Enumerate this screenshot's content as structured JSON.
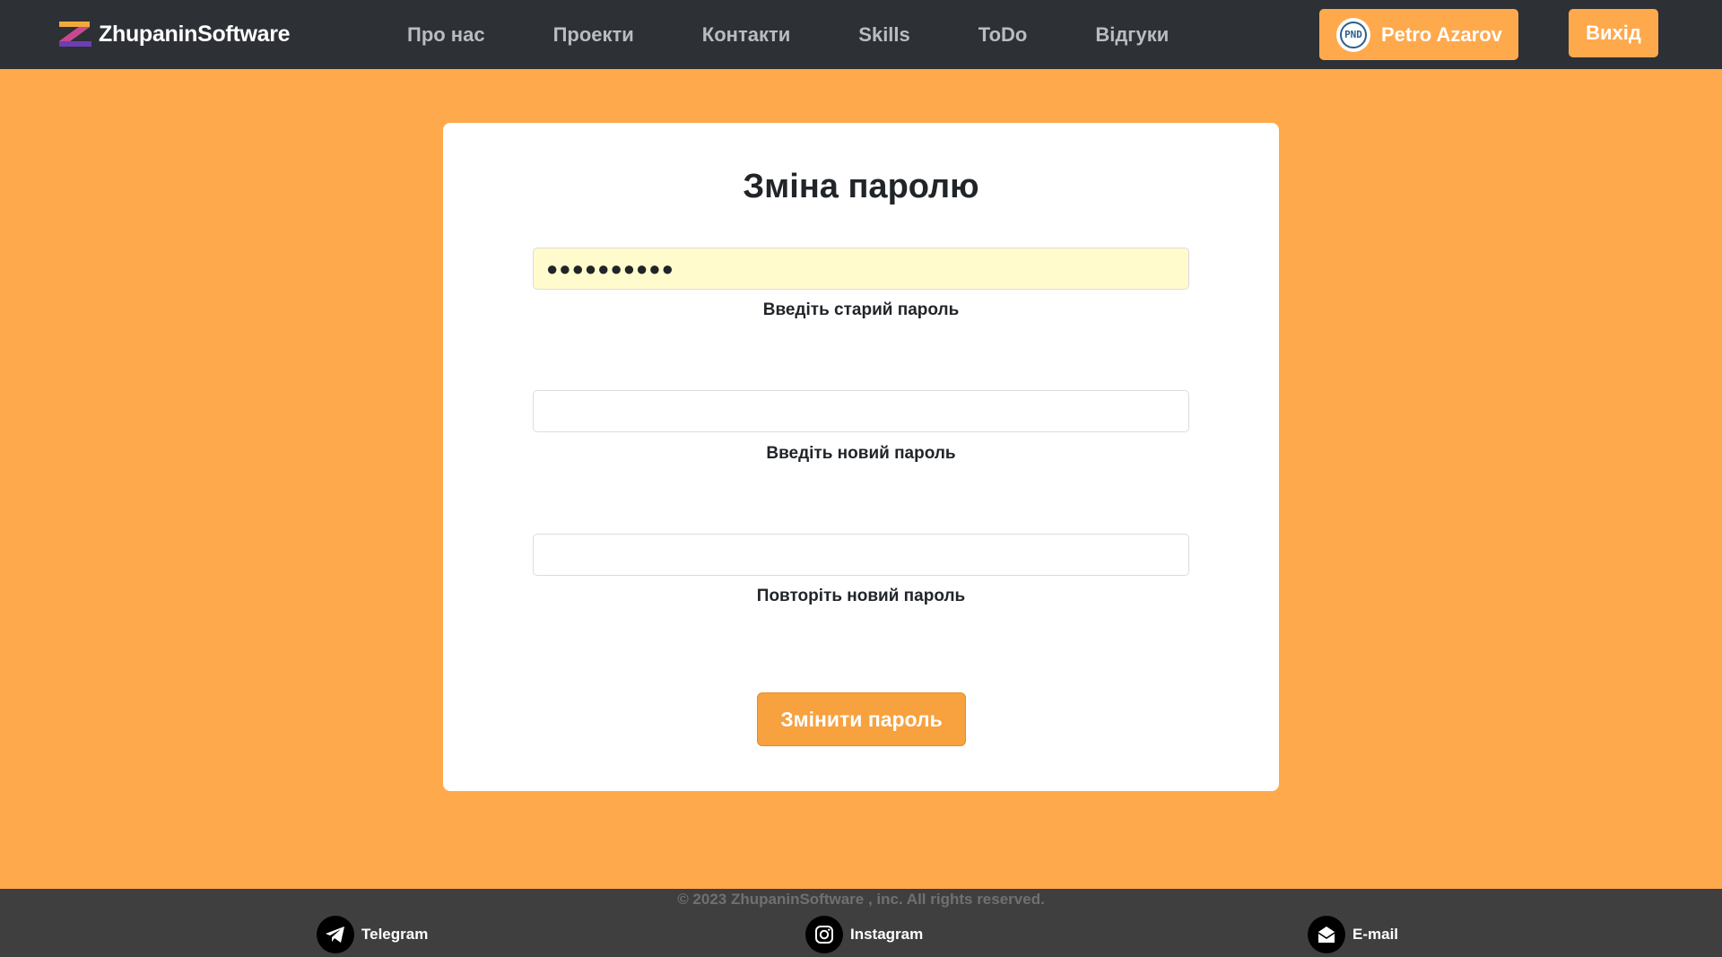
{
  "header": {
    "brand": "ZhupaninSoftware",
    "nav": [
      {
        "label": "Про нас"
      },
      {
        "label": "Проекти"
      },
      {
        "label": "Контакти"
      },
      {
        "label": "Skills"
      },
      {
        "label": "ToDo"
      },
      {
        "label": "Відгуки"
      }
    ],
    "user": {
      "name": "Petro Azarov",
      "avatar_text": "PND"
    },
    "logout_label": "Вихід"
  },
  "form": {
    "title": "Зміна паролю",
    "old_password": {
      "value": "●●●●●●●●●●",
      "label": "Введіть старий пароль"
    },
    "new_password": {
      "value": "",
      "label": "Введіть новий пароль"
    },
    "repeat_password": {
      "value": "",
      "label": "Повторіть новий пароль"
    },
    "submit_label": "Змінити пароль"
  },
  "footer": {
    "copyright": "© 2023 ZhupaninSoftware , inc. All rights reserved.",
    "links": [
      {
        "label": "Telegram",
        "icon": "telegram-icon"
      },
      {
        "label": "Instagram",
        "icon": "instagram-icon"
      },
      {
        "label": "E-mail",
        "icon": "email-icon"
      }
    ]
  },
  "colors": {
    "header_bg": "#2D3034",
    "page_bg": "#FFA94D",
    "accent": "#F7A13F",
    "footer_bg": "#3F3F3F",
    "autofill_bg": "#FFFBCC"
  }
}
